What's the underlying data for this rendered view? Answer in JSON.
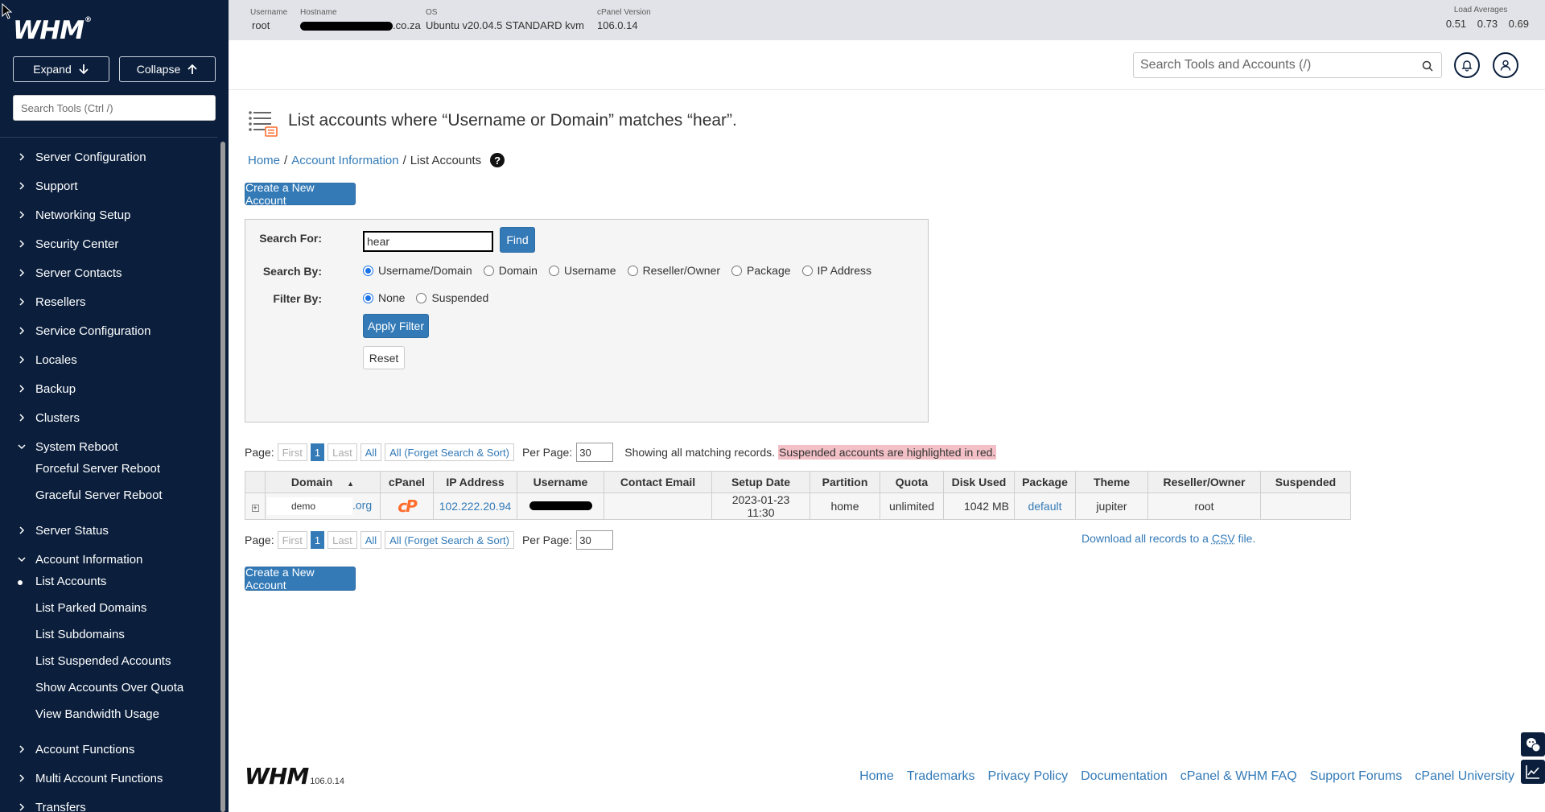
{
  "sidebar": {
    "logo": "WHM",
    "logo_mark": "®",
    "expand_label": "Expand",
    "collapse_label": "Collapse",
    "search_placeholder": "Search Tools (Ctrl /)",
    "items": [
      {
        "label": "Server Configuration",
        "state": "collapsed"
      },
      {
        "label": "Support",
        "state": "collapsed"
      },
      {
        "label": "Networking Setup",
        "state": "collapsed"
      },
      {
        "label": "Security Center",
        "state": "collapsed"
      },
      {
        "label": "Server Contacts",
        "state": "collapsed"
      },
      {
        "label": "Resellers",
        "state": "collapsed"
      },
      {
        "label": "Service Configuration",
        "state": "collapsed"
      },
      {
        "label": "Locales",
        "state": "collapsed"
      },
      {
        "label": "Backup",
        "state": "collapsed"
      },
      {
        "label": "Clusters",
        "state": "collapsed"
      },
      {
        "label": "System Reboot",
        "state": "expanded"
      },
      {
        "label": "Server Status",
        "state": "collapsed"
      },
      {
        "label": "Account Information",
        "state": "expanded"
      },
      {
        "label": "Account Functions",
        "state": "collapsed"
      },
      {
        "label": "Multi Account Functions",
        "state": "collapsed"
      },
      {
        "label": "Transfers",
        "state": "collapsed"
      }
    ],
    "system_reboot_sub": [
      "Forceful Server Reboot",
      "Graceful Server Reboot"
    ],
    "account_info_sub": [
      "List Accounts",
      "List Parked Domains",
      "List Subdomains",
      "List Suspended Accounts",
      "Show Accounts Over Quota",
      "View Bandwidth Usage"
    ],
    "active_sub": "List Accounts"
  },
  "topbar": {
    "username_label": "Username",
    "username": "root",
    "hostname_label": "Hostname",
    "hostname_suffix": ".co.za",
    "os_label": "OS",
    "os": "Ubuntu v20.04.5 STANDARD kvm",
    "version_label": "cPanel Version",
    "version": "106.0.14",
    "load_label": "Load Averages",
    "loads": "0.51 0.73 0.69"
  },
  "header": {
    "search_placeholder": "Search Tools and Accounts (/)"
  },
  "page": {
    "title": "List accounts where “Username or Domain” matches “hear”.",
    "breadcrumb": {
      "home": "Home",
      "section": "Account Information",
      "current": "List Accounts"
    },
    "create_button": "Create a New Account"
  },
  "search_panel": {
    "search_for_label": "Search For:",
    "search_value": "hear",
    "find_label": "Find",
    "search_by_label": "Search By:",
    "search_by_options": [
      "Username/Domain",
      "Domain",
      "Username",
      "Reseller/Owner",
      "Package",
      "IP Address"
    ],
    "search_by_selected": "Username/Domain",
    "filter_by_label": "Filter By:",
    "filter_options": [
      "None",
      "Suspended"
    ],
    "filter_selected": "None",
    "apply_label": "Apply Filter",
    "reset_label": "Reset"
  },
  "pager": {
    "page_label": "Page:",
    "first": "First",
    "current": "1",
    "last": "Last",
    "all": "All",
    "all_forget": "All (Forget Search & Sort)",
    "per_page_label": "Per Page:",
    "per_page": "30",
    "records_note": "Showing all matching records.",
    "suspended_note": "Suspended accounts are highlighted in red."
  },
  "table": {
    "columns": [
      "Domain",
      "cPanel",
      "IP Address",
      "Username",
      "Contact Email",
      "Setup Date",
      "Partition",
      "Quota",
      "Disk Used",
      "Package",
      "Theme",
      "Reseller/Owner",
      "Suspended"
    ],
    "sort_indicator": "▲",
    "rows": [
      {
        "domain_prefix": "demo",
        "domain_suffix": ".org",
        "cpanel": "cP",
        "ip": "102.222.20.94",
        "username": "",
        "contact_email": "",
        "setup_date": "2023-01-23 11:30",
        "partition": "home",
        "quota": "unlimited",
        "disk_used": "1042 MB",
        "package": "default",
        "theme": "jupiter",
        "owner": "root",
        "suspended": ""
      }
    ],
    "expander": "+"
  },
  "csv": {
    "prefix": "Download all records to a ",
    "abbr": "CSV",
    "suffix": " file."
  },
  "footer": {
    "logo": "WHM",
    "version": "106.0.14",
    "links": [
      "Home",
      "Trademarks",
      "Privacy Policy",
      "Documentation",
      "cPanel & WHM FAQ",
      "Support Forums",
      "cPanel University"
    ]
  },
  "colors": {
    "sidebar_bg": "#0b1f3d",
    "primary": "#337ab7",
    "suspended_highlight": "#f2c0c6",
    "cpanel_orange": "#ff6c2c"
  }
}
